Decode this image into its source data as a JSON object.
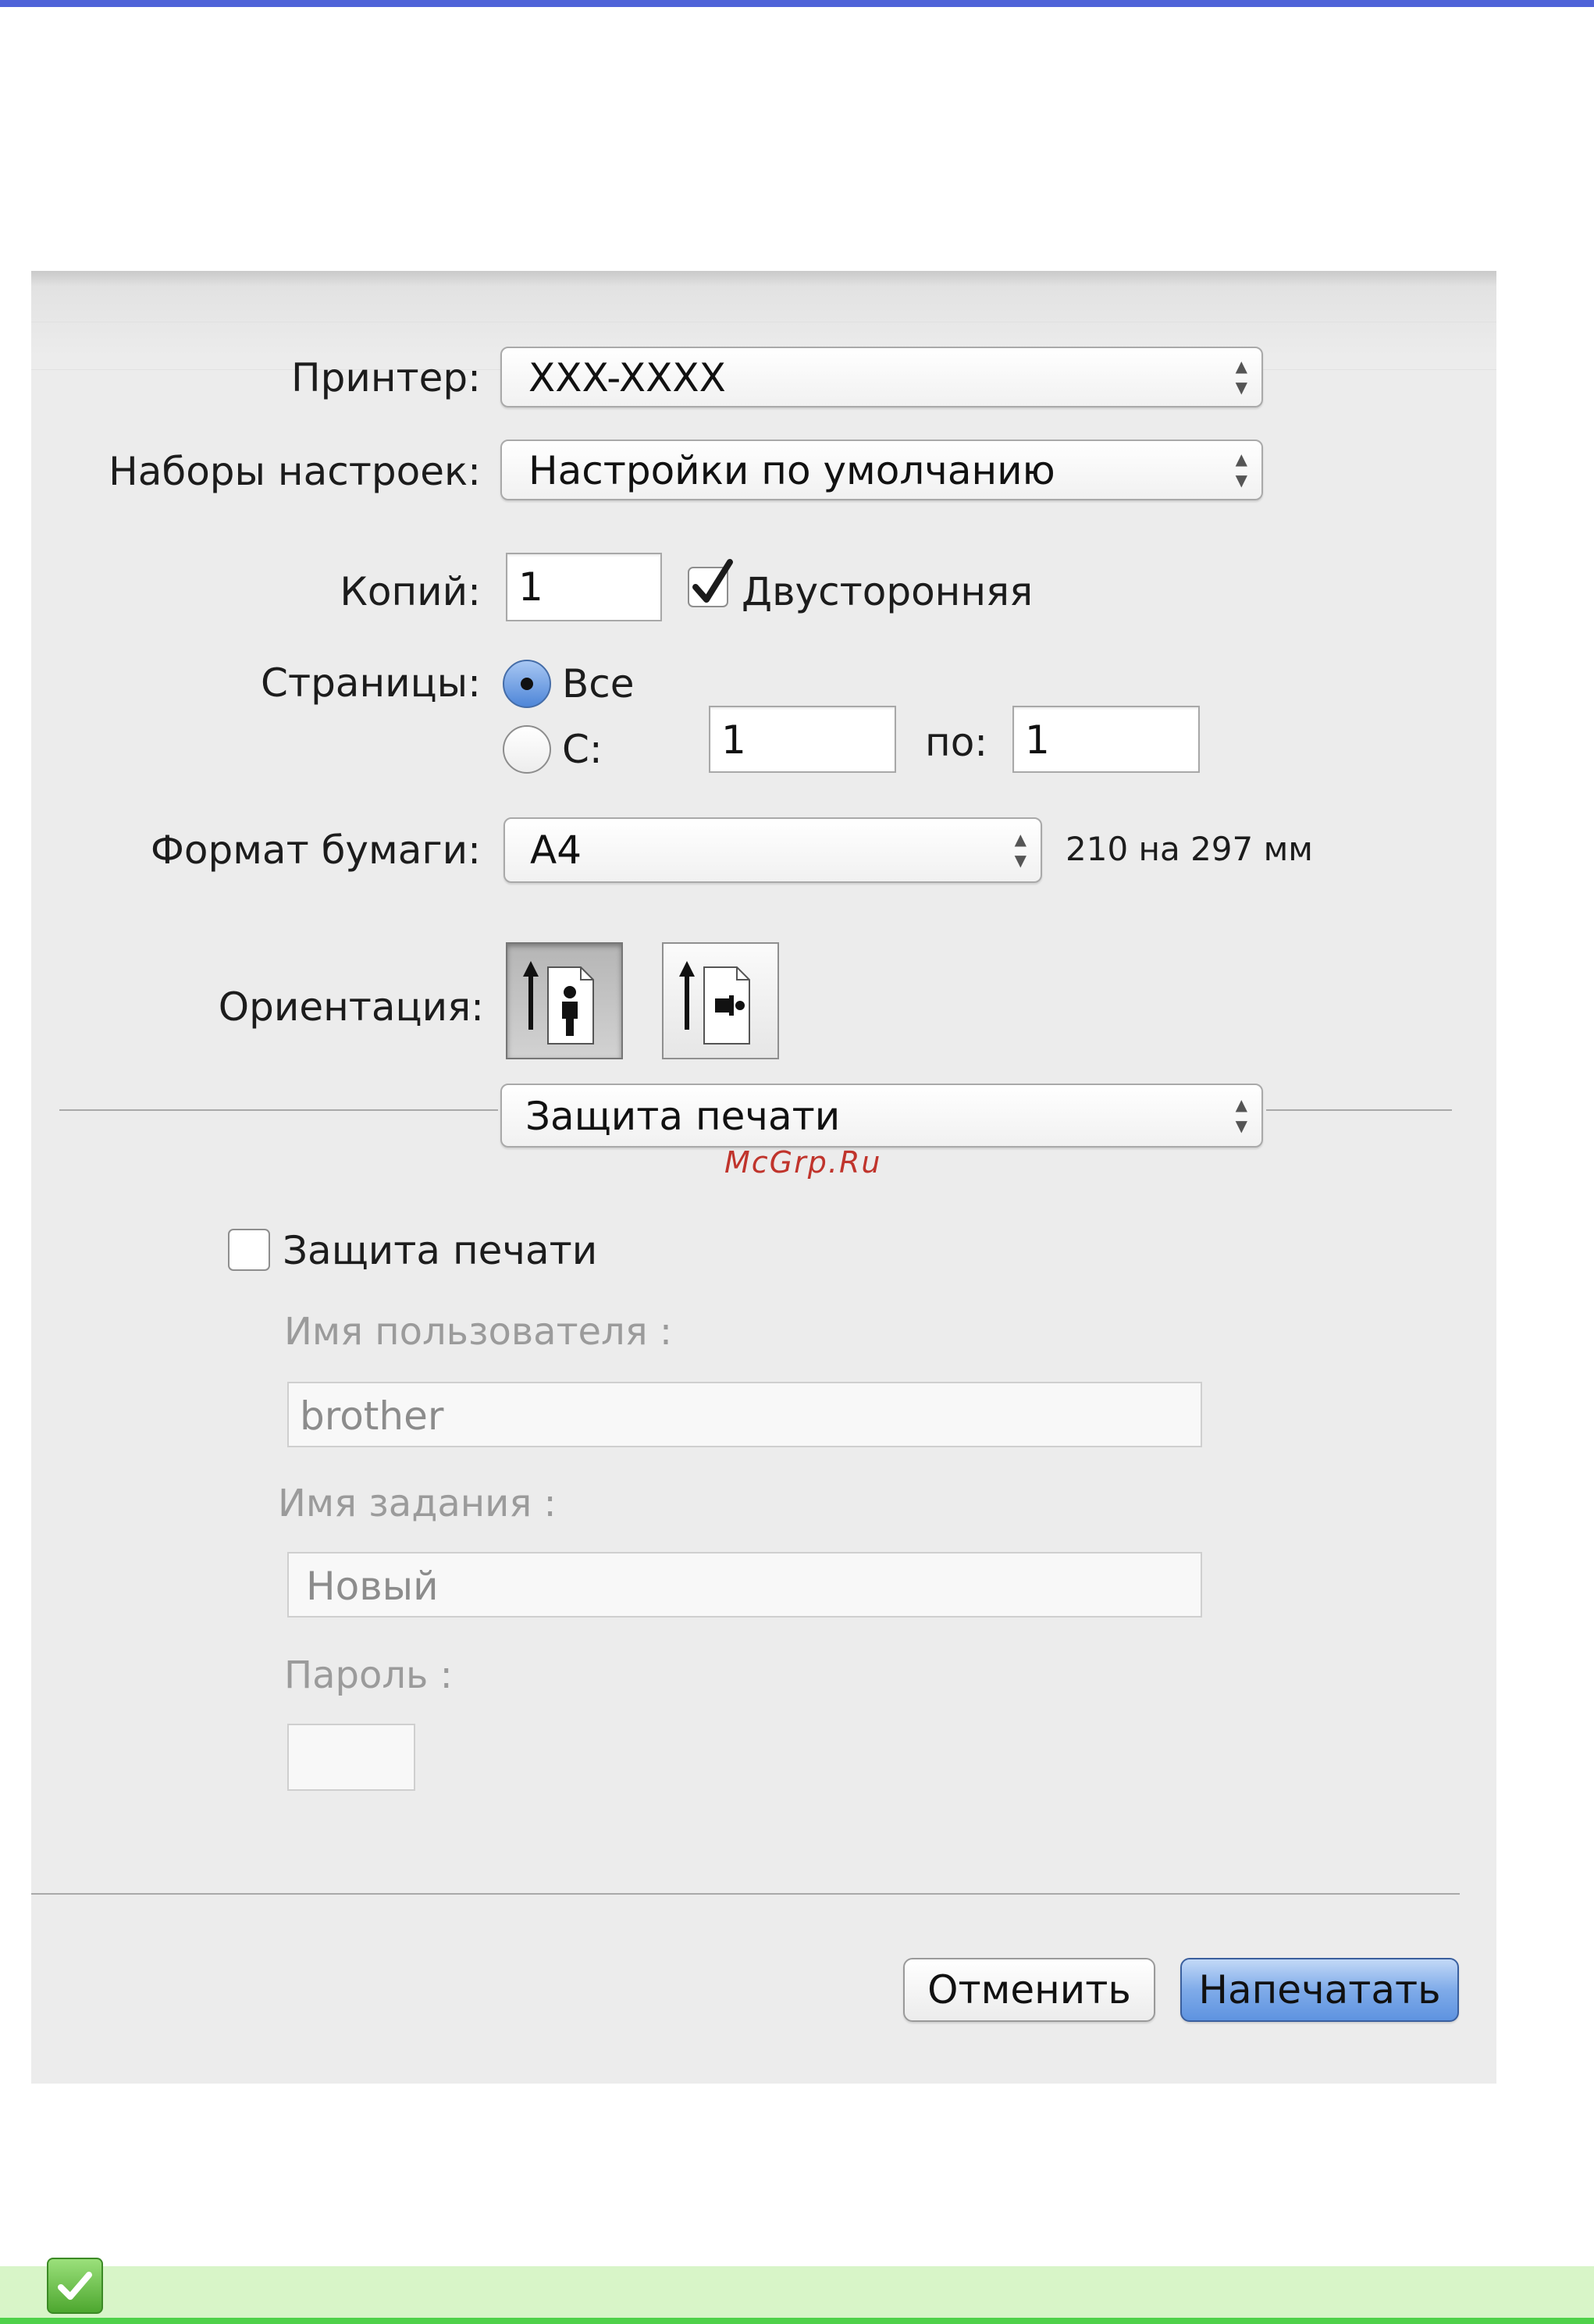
{
  "printer": {
    "label": "Принтер:",
    "value": "XXX-XXXX"
  },
  "presets": {
    "label": "Наборы настроек:",
    "value": "Настройки по умолчанию"
  },
  "copies": {
    "label": "Копий:",
    "value": "1",
    "duplex_label": "Двусторонняя",
    "duplex_checked": true
  },
  "pages": {
    "label": "Страницы:",
    "all_label": "Все",
    "range_label": "С:",
    "from_value": "1",
    "to_label": "по:",
    "to_value": "1",
    "selected": "all"
  },
  "paper": {
    "label": "Формат бумаги:",
    "value": "A4",
    "size_text": "210 на 297 мм"
  },
  "orientation": {
    "label": "Ориентация:",
    "selected": "portrait",
    "options": [
      "portrait",
      "landscape"
    ]
  },
  "section_popup": {
    "value": "Защита печати"
  },
  "watermark": "McGrp.Ru",
  "secure": {
    "checkbox_label": "Защита печати",
    "checked": false,
    "username_label": "Имя пользователя :",
    "username_value": "brother",
    "jobname_label": "Имя задания :",
    "jobname_value": "Новый",
    "password_label": "Пароль :",
    "password_value": ""
  },
  "buttons": {
    "cancel": "Отменить",
    "print": "Напечатать"
  },
  "colors": {
    "accent_bar": "#4f63d8",
    "primary_button": "#6f9fe6",
    "note_bar": "#4fd14a"
  },
  "icons": [
    "popup-arrows-icon",
    "checkmark-icon",
    "portrait-orientation-icon",
    "landscape-orientation-icon",
    "note-check-icon"
  ]
}
